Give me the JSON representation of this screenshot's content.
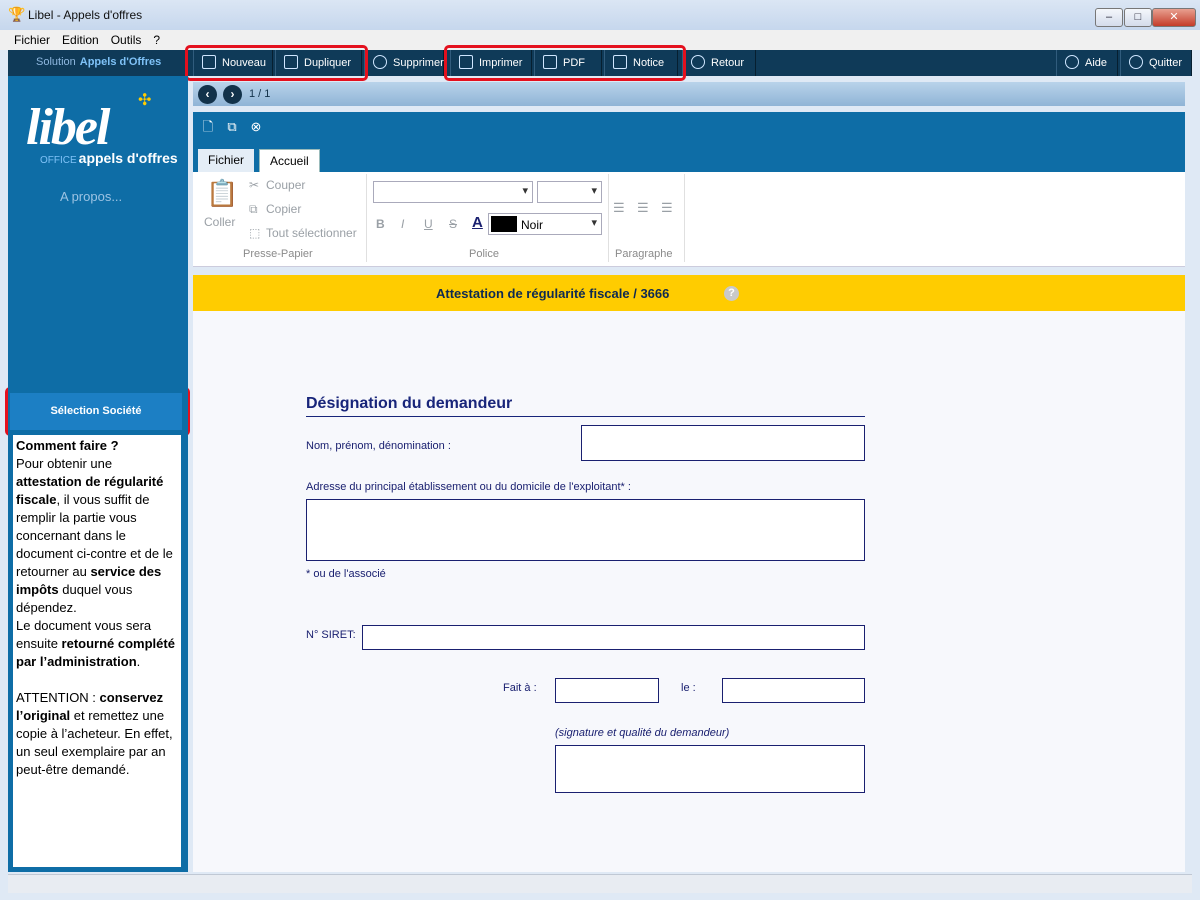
{
  "window": {
    "title": "Libel - Appels d'offres"
  },
  "menubar": [
    "Fichier",
    "Edition",
    "Outils",
    "?"
  ],
  "toolbar": {
    "solution_label": "Solution",
    "solution_name": "Appels d'Offres",
    "buttons": [
      "Nouveau",
      "Dupliquer",
      "Supprimer",
      "Imprimer",
      "PDF",
      "Notice",
      "Retour",
      "Aide",
      "Quitter"
    ]
  },
  "sidebar": {
    "logo": "libel",
    "logo_prefix": "OFFICE",
    "logo_sub": "appels d'offres",
    "apropos": "A propos...",
    "select_button": "Sélection Société",
    "help": {
      "heading": "Comment faire ?",
      "p1_a": "Pour obtenir une ",
      "p1_b": "attestation de régularité fiscale",
      "p1_c": ", il vous suffit de remplir la partie vous concernant dans le document ci-contre et de le retourner au ",
      "p1_d": "service des impôts",
      "p1_e": " duquel vous dépendez.",
      "p2_a": "Le document vous sera ensuite ",
      "p2_b": "retourné complété par l’administration",
      "p2_c": ".",
      "p3_a": "ATTENTION : ",
      "p3_b": "conservez l’original",
      "p3_c": " et remettez une copie à l’acheteur. En effet, un seul exemplaire par an peut-être demandé."
    }
  },
  "nav": {
    "pagecount": "1 / 1"
  },
  "ribbon": {
    "tabs": [
      "Fichier",
      "Accueil"
    ],
    "clipboard": {
      "paste": "Coller",
      "cut": "Couper",
      "copy": "Copier",
      "select_all": "Tout sélectionner",
      "label": "Presse-Papier"
    },
    "font": {
      "bold": "B",
      "italic": "I",
      "underline": "U",
      "strike": "S",
      "color_a": "A",
      "color_name": "Noir",
      "label": "Police"
    },
    "paragraph": {
      "label": "Paragraphe"
    }
  },
  "document": {
    "title": "Attestation de régularité fiscale / 3666",
    "help_icon": "?",
    "section_title": "Désignation du demandeur",
    "fields": {
      "name_label": "Nom, prénom, dénomination :",
      "address_label": "Adresse du principal établissement ou du domicile de l'exploitant* :",
      "address_note": "* ou de l'associé",
      "siret_label": "N° SIRET:",
      "fait_label": "Fait à :",
      "le_label": "le :",
      "signature_label": "(signature et qualité du demandeur)"
    }
  }
}
